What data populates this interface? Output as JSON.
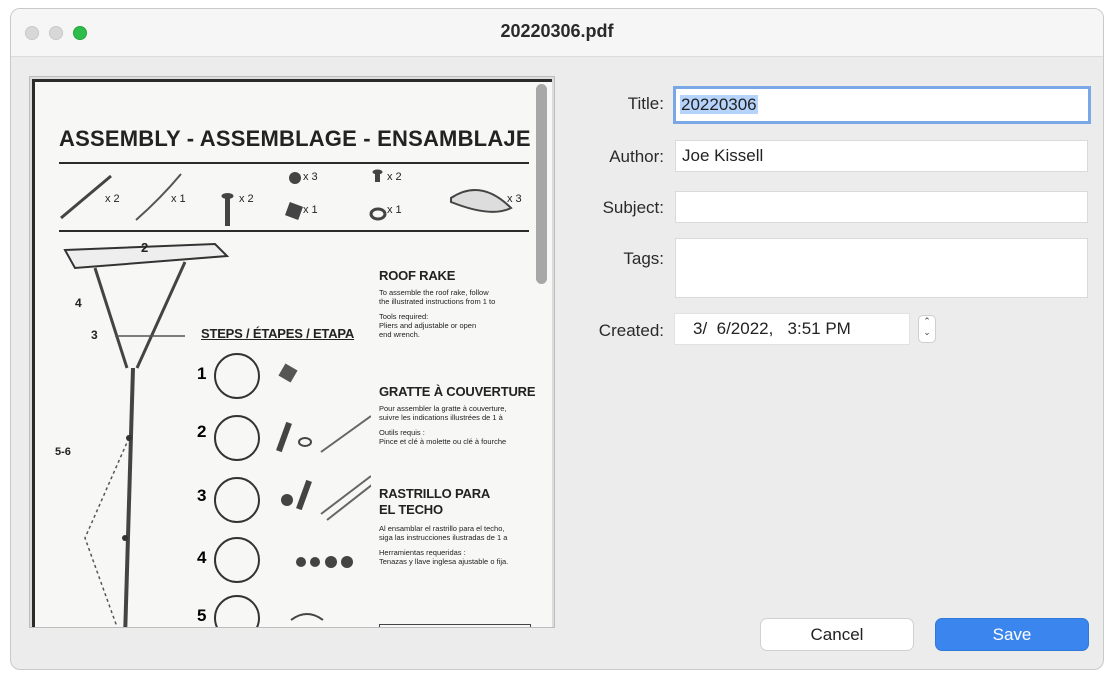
{
  "window": {
    "title": "20220306.pdf"
  },
  "preview": {
    "heading": "ASSEMBLY - ASSEMBLAGE - ENSAMBLAJE",
    "qty_1": "x 2",
    "qty_2": "x 1",
    "qty_3": "x 2",
    "qty_4": "x 3",
    "qty_5": "x 1",
    "qty_6": "x 2",
    "qty_7": "x 1",
    "qty_8": "x 3",
    "steps_title": "STEPS / ÉTAPES / ETAPA",
    "callout_2": "2",
    "callout_3": "3",
    "callout_4": "4",
    "callout_56": "5-6",
    "step_1": "1",
    "step_2": "2",
    "step_3": "3",
    "step_4": "4",
    "step_5": "5",
    "en_title": "ROOF RAKE",
    "en_line1": "To assemble the roof rake, follow",
    "en_line2": "the illustrated instructions from 1 to",
    "en_tools1": "Tools required:",
    "en_tools2": "Pliers and adjustable or open",
    "en_tools3": "end wrench.",
    "fr_title": "GRATTE À COUVERTURE",
    "fr_line1": "Pour assembler la gratte à couverture,",
    "fr_line2": "suivre les indications illustrées de 1 à",
    "fr_tools1": "Outils requis :",
    "fr_tools2": "Pince et clé à molette ou clé à fourche",
    "es_title1": "RASTRILLO PARA",
    "es_title2": "EL TECHO",
    "es_line1": "Al ensamblar el rastrillo para el techo,",
    "es_line2": "siga las instrucciones ilustradas de 1 a",
    "es_tools1": "Herramientas requeridas :",
    "es_tools2": "Tenazas y llave inglesa ajustable o fija."
  },
  "form": {
    "title_label": "Title:",
    "title_value": "20220306",
    "author_label": "Author:",
    "author_value": "Joe Kissell",
    "subject_label": "Subject:",
    "subject_value": "",
    "tags_label": "Tags:",
    "tags_value": "",
    "created_label": "Created:",
    "created_value": "3/  6/2022,   3:51 PM"
  },
  "buttons": {
    "cancel": "Cancel",
    "save": "Save"
  },
  "colors": {
    "accent": "#3b86ee",
    "focus_ring": "#7aa7e6",
    "selection": "#b6d4fb",
    "zoom_light": "#2dbd4a"
  }
}
